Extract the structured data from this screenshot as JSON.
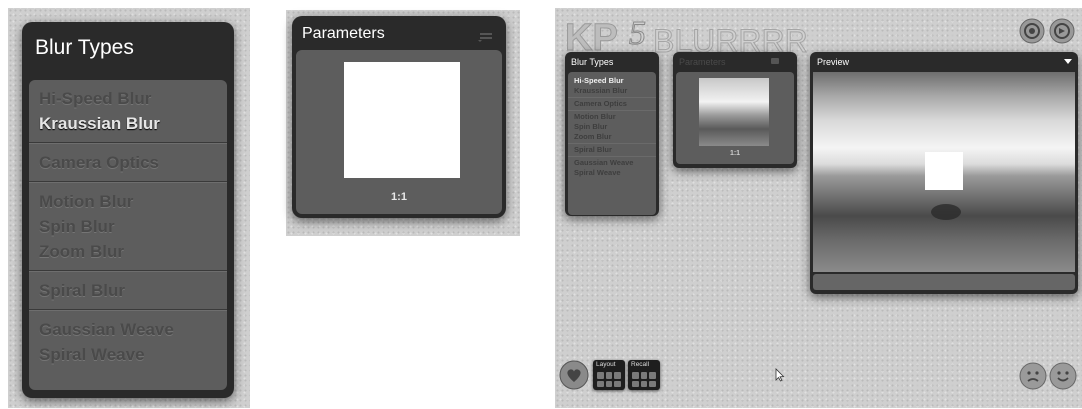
{
  "blur_types_panel": {
    "title": "Blur Types",
    "groups": [
      [
        "Hi-Speed Blur",
        "Kraussian Blur"
      ],
      [
        "Camera Optics"
      ],
      [
        "Motion Blur",
        "Spin Blur",
        "Zoom Blur"
      ],
      [
        "Spiral Blur"
      ],
      [
        "Gaussian Weave",
        "Spiral Weave"
      ]
    ],
    "selected": "Kraussian Blur"
  },
  "parameters_panel": {
    "title": "Parameters",
    "zoom_label": "1:1"
  },
  "app": {
    "logo_text": "KPT5 BLURRRR",
    "mini_blur_types": {
      "title": "Blur Types",
      "groups": [
        [
          "Hi-Speed Blur",
          "Kraussian Blur"
        ],
        [
          "Camera Optics"
        ],
        [
          "Motion Blur",
          "Spin Blur",
          "Zoom Blur"
        ],
        [
          "Spiral Blur"
        ],
        [
          "Gaussian Weave",
          "Spiral Weave"
        ]
      ],
      "selected": "Hi-Speed Blur"
    },
    "mini_parameters": {
      "title": "Parameters",
      "zoom_label": "1:1"
    },
    "preview": {
      "title": "Preview"
    },
    "buttons": {
      "layout_label": "Layout",
      "recall_label": "Recall"
    }
  },
  "colors": {
    "panel_dark": "#2a2a2a",
    "panel_body": "#5d5d5d",
    "background_texture": "#cfcfcf",
    "selected_text": "#e6e6e6"
  }
}
